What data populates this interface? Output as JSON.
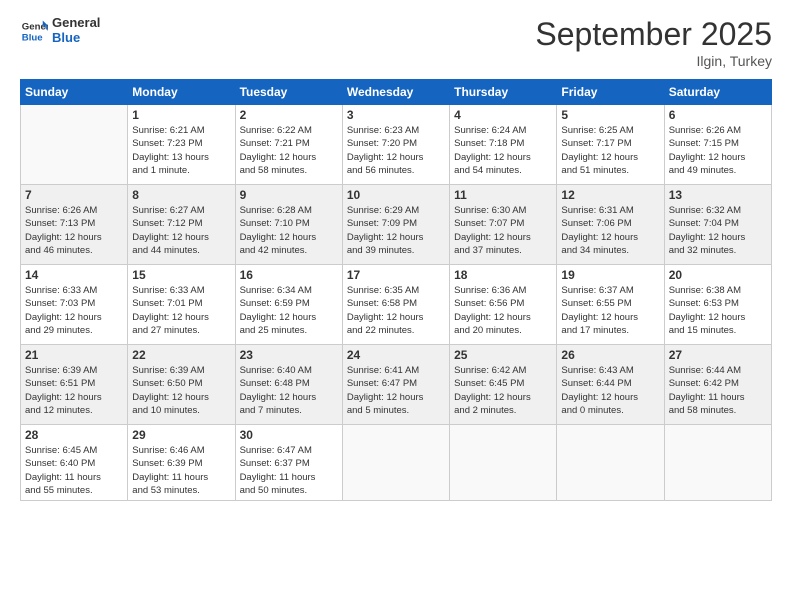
{
  "logo": {
    "general": "General",
    "blue": "Blue"
  },
  "header": {
    "month": "September 2025",
    "location": "Ilgin, Turkey"
  },
  "days_of_week": [
    "Sunday",
    "Monday",
    "Tuesday",
    "Wednesday",
    "Thursday",
    "Friday",
    "Saturday"
  ],
  "weeks": [
    [
      {
        "num": "",
        "info": "",
        "empty": true
      },
      {
        "num": "1",
        "info": "Sunrise: 6:21 AM\nSunset: 7:23 PM\nDaylight: 13 hours\nand 1 minute."
      },
      {
        "num": "2",
        "info": "Sunrise: 6:22 AM\nSunset: 7:21 PM\nDaylight: 12 hours\nand 58 minutes."
      },
      {
        "num": "3",
        "info": "Sunrise: 6:23 AM\nSunset: 7:20 PM\nDaylight: 12 hours\nand 56 minutes."
      },
      {
        "num": "4",
        "info": "Sunrise: 6:24 AM\nSunset: 7:18 PM\nDaylight: 12 hours\nand 54 minutes."
      },
      {
        "num": "5",
        "info": "Sunrise: 6:25 AM\nSunset: 7:17 PM\nDaylight: 12 hours\nand 51 minutes."
      },
      {
        "num": "6",
        "info": "Sunrise: 6:26 AM\nSunset: 7:15 PM\nDaylight: 12 hours\nand 49 minutes."
      }
    ],
    [
      {
        "num": "7",
        "info": "Sunrise: 6:26 AM\nSunset: 7:13 PM\nDaylight: 12 hours\nand 46 minutes."
      },
      {
        "num": "8",
        "info": "Sunrise: 6:27 AM\nSunset: 7:12 PM\nDaylight: 12 hours\nand 44 minutes."
      },
      {
        "num": "9",
        "info": "Sunrise: 6:28 AM\nSunset: 7:10 PM\nDaylight: 12 hours\nand 42 minutes."
      },
      {
        "num": "10",
        "info": "Sunrise: 6:29 AM\nSunset: 7:09 PM\nDaylight: 12 hours\nand 39 minutes."
      },
      {
        "num": "11",
        "info": "Sunrise: 6:30 AM\nSunset: 7:07 PM\nDaylight: 12 hours\nand 37 minutes."
      },
      {
        "num": "12",
        "info": "Sunrise: 6:31 AM\nSunset: 7:06 PM\nDaylight: 12 hours\nand 34 minutes."
      },
      {
        "num": "13",
        "info": "Sunrise: 6:32 AM\nSunset: 7:04 PM\nDaylight: 12 hours\nand 32 minutes."
      }
    ],
    [
      {
        "num": "14",
        "info": "Sunrise: 6:33 AM\nSunset: 7:03 PM\nDaylight: 12 hours\nand 29 minutes."
      },
      {
        "num": "15",
        "info": "Sunrise: 6:33 AM\nSunset: 7:01 PM\nDaylight: 12 hours\nand 27 minutes."
      },
      {
        "num": "16",
        "info": "Sunrise: 6:34 AM\nSunset: 6:59 PM\nDaylight: 12 hours\nand 25 minutes."
      },
      {
        "num": "17",
        "info": "Sunrise: 6:35 AM\nSunset: 6:58 PM\nDaylight: 12 hours\nand 22 minutes."
      },
      {
        "num": "18",
        "info": "Sunrise: 6:36 AM\nSunset: 6:56 PM\nDaylight: 12 hours\nand 20 minutes."
      },
      {
        "num": "19",
        "info": "Sunrise: 6:37 AM\nSunset: 6:55 PM\nDaylight: 12 hours\nand 17 minutes."
      },
      {
        "num": "20",
        "info": "Sunrise: 6:38 AM\nSunset: 6:53 PM\nDaylight: 12 hours\nand 15 minutes."
      }
    ],
    [
      {
        "num": "21",
        "info": "Sunrise: 6:39 AM\nSunset: 6:51 PM\nDaylight: 12 hours\nand 12 minutes."
      },
      {
        "num": "22",
        "info": "Sunrise: 6:39 AM\nSunset: 6:50 PM\nDaylight: 12 hours\nand 10 minutes."
      },
      {
        "num": "23",
        "info": "Sunrise: 6:40 AM\nSunset: 6:48 PM\nDaylight: 12 hours\nand 7 minutes."
      },
      {
        "num": "24",
        "info": "Sunrise: 6:41 AM\nSunset: 6:47 PM\nDaylight: 12 hours\nand 5 minutes."
      },
      {
        "num": "25",
        "info": "Sunrise: 6:42 AM\nSunset: 6:45 PM\nDaylight: 12 hours\nand 2 minutes."
      },
      {
        "num": "26",
        "info": "Sunrise: 6:43 AM\nSunset: 6:44 PM\nDaylight: 12 hours\nand 0 minutes."
      },
      {
        "num": "27",
        "info": "Sunrise: 6:44 AM\nSunset: 6:42 PM\nDaylight: 11 hours\nand 58 minutes."
      }
    ],
    [
      {
        "num": "28",
        "info": "Sunrise: 6:45 AM\nSunset: 6:40 PM\nDaylight: 11 hours\nand 55 minutes."
      },
      {
        "num": "29",
        "info": "Sunrise: 6:46 AM\nSunset: 6:39 PM\nDaylight: 11 hours\nand 53 minutes."
      },
      {
        "num": "30",
        "info": "Sunrise: 6:47 AM\nSunset: 6:37 PM\nDaylight: 11 hours\nand 50 minutes."
      },
      {
        "num": "",
        "info": "",
        "empty": true
      },
      {
        "num": "",
        "info": "",
        "empty": true
      },
      {
        "num": "",
        "info": "",
        "empty": true
      },
      {
        "num": "",
        "info": "",
        "empty": true
      }
    ]
  ]
}
